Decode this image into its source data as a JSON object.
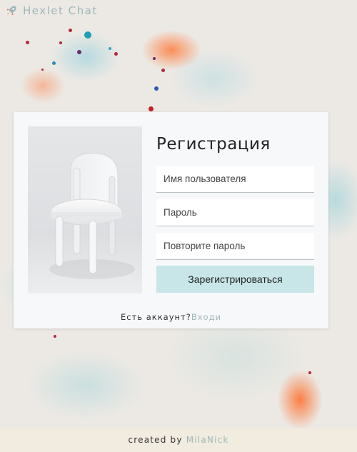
{
  "header": {
    "brand": "Hexlet Chat",
    "logo_icon": "rocket-icon"
  },
  "colors": {
    "accent": "#9fb7b9",
    "button": "#c8e5e7",
    "card": "#f7f8f9",
    "footer": "#f1ebe0"
  },
  "signup": {
    "image_icon": "chair-photo",
    "title": "Регистрация",
    "username_placeholder": "Имя пользователя",
    "password_placeholder": "Пароль",
    "confirm_placeholder": "Повторите пароль",
    "submit_label": "Зарегистрироваться",
    "have_account_text": "Есть аккаунт?",
    "login_link": "Входи"
  },
  "footer": {
    "created_by": "created by",
    "author": "MilaNick"
  }
}
